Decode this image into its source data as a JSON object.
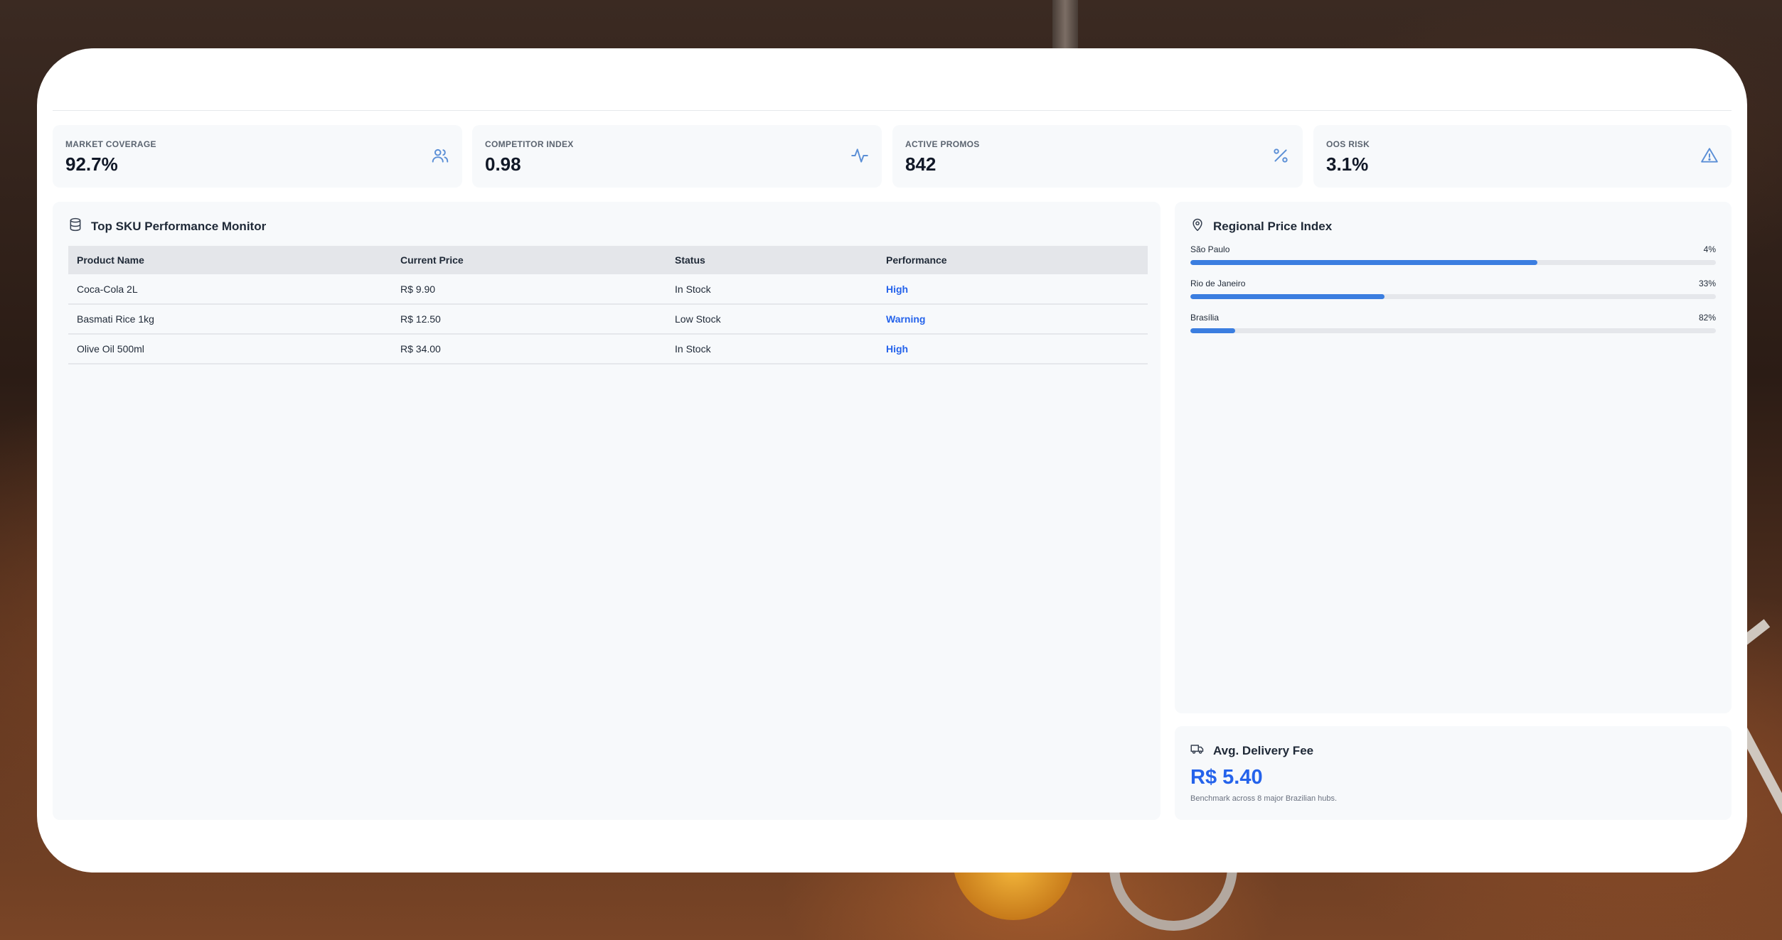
{
  "kpis": [
    {
      "label": "MARKET COVERAGE",
      "value": "92.7%",
      "icon": "users-icon"
    },
    {
      "label": "COMPETITOR INDEX",
      "value": "0.98",
      "icon": "activity-icon"
    },
    {
      "label": "ACTIVE PROMOS",
      "value": "842",
      "icon": "percent-icon"
    },
    {
      "label": "OOS RISK",
      "value": "3.1%",
      "icon": "alert-triangle-icon"
    }
  ],
  "sku_panel": {
    "title": "Top SKU Performance Monitor",
    "icon": "database-icon",
    "columns": [
      "Product Name",
      "Current Price",
      "Status",
      "Performance"
    ],
    "rows": [
      {
        "product": "Coca-Cola 2L",
        "price": "R$ 9.90",
        "status": "In Stock",
        "performance": "High"
      },
      {
        "product": "Basmati Rice 1kg",
        "price": "R$ 12.50",
        "status": "Low Stock",
        "performance": "Warning"
      },
      {
        "product": "Olive Oil 500ml",
        "price": "R$ 34.00",
        "status": "In Stock",
        "performance": "High"
      }
    ]
  },
  "region_panel": {
    "title": "Regional Price Index",
    "icon": "map-pin-icon",
    "accent": "#3b7ee0",
    "regions": [
      {
        "name": "São Paulo",
        "label": "4%",
        "fill_fraction": 0.66
      },
      {
        "name": "Rio de Janeiro",
        "label": "33%",
        "fill_fraction": 0.37
      },
      {
        "name": "Brasília",
        "label": "82%",
        "fill_fraction": 0.085
      }
    ]
  },
  "delivery_panel": {
    "title": "Avg. Delivery Fee",
    "icon": "truck-icon",
    "value": "R$ 5.40",
    "note": "Benchmark across 8 major Brazilian hubs."
  }
}
